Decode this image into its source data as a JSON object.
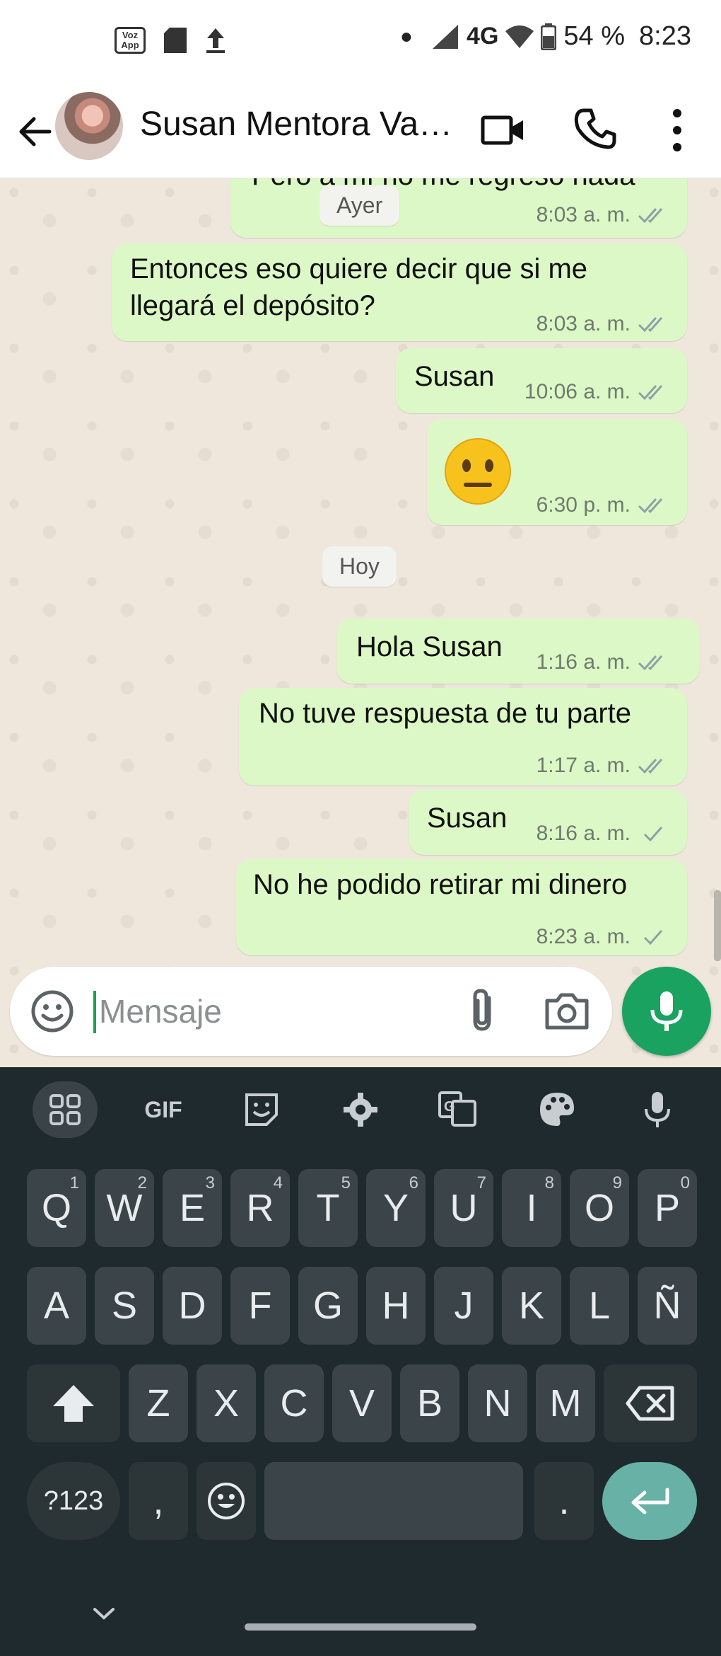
{
  "status_bar": {
    "app_badge_text": "Voz App",
    "network": "4G",
    "battery": "54 %",
    "time": "8:23"
  },
  "header": {
    "contact_name": "Susan Mentora Va…"
  },
  "chat": {
    "partial_message": {
      "text": "Pero a mí no me regreso nada",
      "time": "8:03 a. m."
    },
    "date_chips": [
      "Ayer",
      "Hoy"
    ],
    "messages": [
      {
        "text": "Entonces eso quiere decir que si me llegará el depósito?",
        "time": "8:03 a. m.",
        "status": "read"
      },
      {
        "text": "Susan",
        "time": "10:06 a. m.",
        "status": "read"
      },
      {
        "text": "😐",
        "time": "6:30 p. m.",
        "status": "read"
      },
      {
        "text": "Hola Susan",
        "time": "1:16 a. m.",
        "status": "read"
      },
      {
        "text": "No tuve respuesta de tu parte",
        "time": "1:17 a. m.",
        "status": "read"
      },
      {
        "text": "Susan",
        "time": "8:16 a. m.",
        "status": "sent"
      },
      {
        "text": "No he podido retirar mi dinero",
        "time": "8:23 a. m.",
        "status": "sent"
      }
    ]
  },
  "composer": {
    "placeholder": "Mensaje"
  },
  "keyboard": {
    "toolbar": [
      "grid",
      "GIF",
      "sticker",
      "settings",
      "translate",
      "theme",
      "voice"
    ],
    "gif_label": "GIF",
    "row1": [
      {
        "key": "Q",
        "hint": "1"
      },
      {
        "key": "W",
        "hint": "2"
      },
      {
        "key": "E",
        "hint": "3"
      },
      {
        "key": "R",
        "hint": "4"
      },
      {
        "key": "T",
        "hint": "5"
      },
      {
        "key": "Y",
        "hint": "6"
      },
      {
        "key": "U",
        "hint": "7"
      },
      {
        "key": "I",
        "hint": "8"
      },
      {
        "key": "O",
        "hint": "9"
      },
      {
        "key": "P",
        "hint": "0"
      }
    ],
    "row2": [
      "A",
      "S",
      "D",
      "F",
      "G",
      "H",
      "J",
      "K",
      "L",
      "Ñ"
    ],
    "row3": [
      "Z",
      "X",
      "C",
      "V",
      "B",
      "N",
      "M"
    ],
    "row4": {
      "symbols": "?123",
      "comma": ",",
      "period": "."
    }
  },
  "colors": {
    "bubble_out": "#dcf8c6",
    "accent_green": "#1aa260",
    "keyboard_bg": "#1f2a2e",
    "read_tick": "#53bdeb"
  }
}
